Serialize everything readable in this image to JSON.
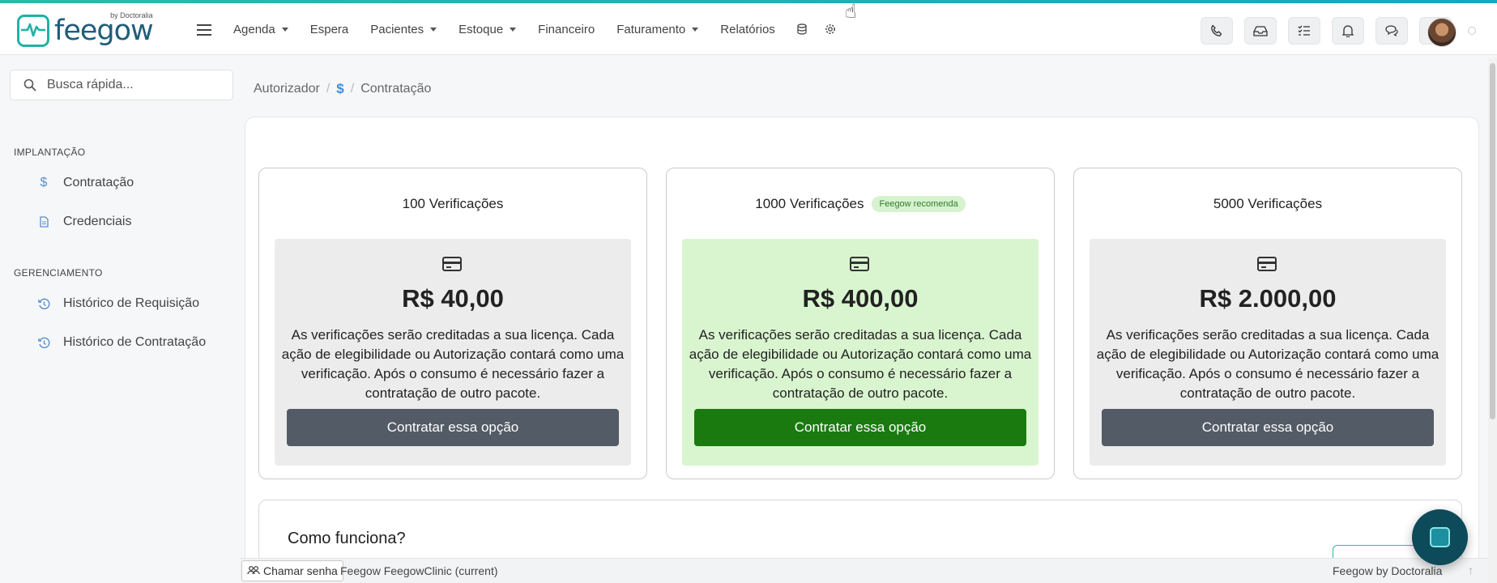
{
  "brand": {
    "name": "feegow",
    "by": "by Doctoralia",
    "accent": "#1fb3a5"
  },
  "nav": {
    "items": [
      {
        "label": "Agenda",
        "dropdown": true
      },
      {
        "label": "Espera",
        "dropdown": false
      },
      {
        "label": "Pacientes",
        "dropdown": true
      },
      {
        "label": "Estoque",
        "dropdown": true
      },
      {
        "label": "Financeiro",
        "dropdown": false
      },
      {
        "label": "Faturamento",
        "dropdown": true
      },
      {
        "label": "Relatórios",
        "dropdown": false
      }
    ],
    "icons": [
      "database-icon",
      "settings-icon"
    ]
  },
  "header_buttons": [
    "phone-icon",
    "inbox-icon",
    "checklist-icon",
    "bell-icon",
    "chat-icon",
    "help-icon"
  ],
  "search": {
    "placeholder": "Busca rápida..."
  },
  "sidebar": {
    "sections": [
      {
        "title": "IMPLANTAÇÃO",
        "items": [
          {
            "label": "Contratação",
            "icon": "dollar-icon"
          },
          {
            "label": "Credenciais",
            "icon": "document-icon"
          }
        ]
      },
      {
        "title": "GERENCIAMENTO",
        "items": [
          {
            "label": "Histórico de Requisição",
            "icon": "history-icon"
          },
          {
            "label": "Histórico de Contratação",
            "icon": "history-icon"
          }
        ]
      }
    ]
  },
  "breadcrumb": {
    "root": "Autorizador",
    "current": "Contratação"
  },
  "plans": [
    {
      "title": "100 Verificações",
      "badge": "",
      "price": "R$ 40,00",
      "description": "As verificações serão creditadas a sua licença. Cada ação de elegibilidade ou Autorização contará como uma verificação. Após o consumo é necessário fazer a contratação de outro pacote.",
      "cta": "Contratar essa opção",
      "highlight": false
    },
    {
      "title": "1000 Verificações",
      "badge": "Feegow recomenda",
      "price": "R$ 400,00",
      "description": "As verificações serão creditadas a sua licença. Cada ação de elegibilidade ou Autorização contará como uma verificação. Após o consumo é necessário fazer a contratação de outro pacote.",
      "cta": "Contratar essa opção",
      "highlight": true
    },
    {
      "title": "5000 Verificações",
      "badge": "",
      "price": "R$ 2.000,00",
      "description": "As verificações serão creditadas a sua licença. Cada ação de elegibilidade ou Autorização contará como uma verificação. Após o consumo é necessário fazer a contratação de outro pacote.",
      "cta": "Contratar essa opção",
      "highlight": false
    }
  ],
  "how_it_works": {
    "title": "Como funciona?"
  },
  "footer": {
    "call_button": "Chamar senha",
    "version": "Feegow FeegowClinic (current)",
    "brand": "Feegow by Doctoralia"
  },
  "colors": {
    "cta_default": "#535b66",
    "cta_highlight": "#1a7a10",
    "highlight_bg": "#d9f5cf"
  }
}
